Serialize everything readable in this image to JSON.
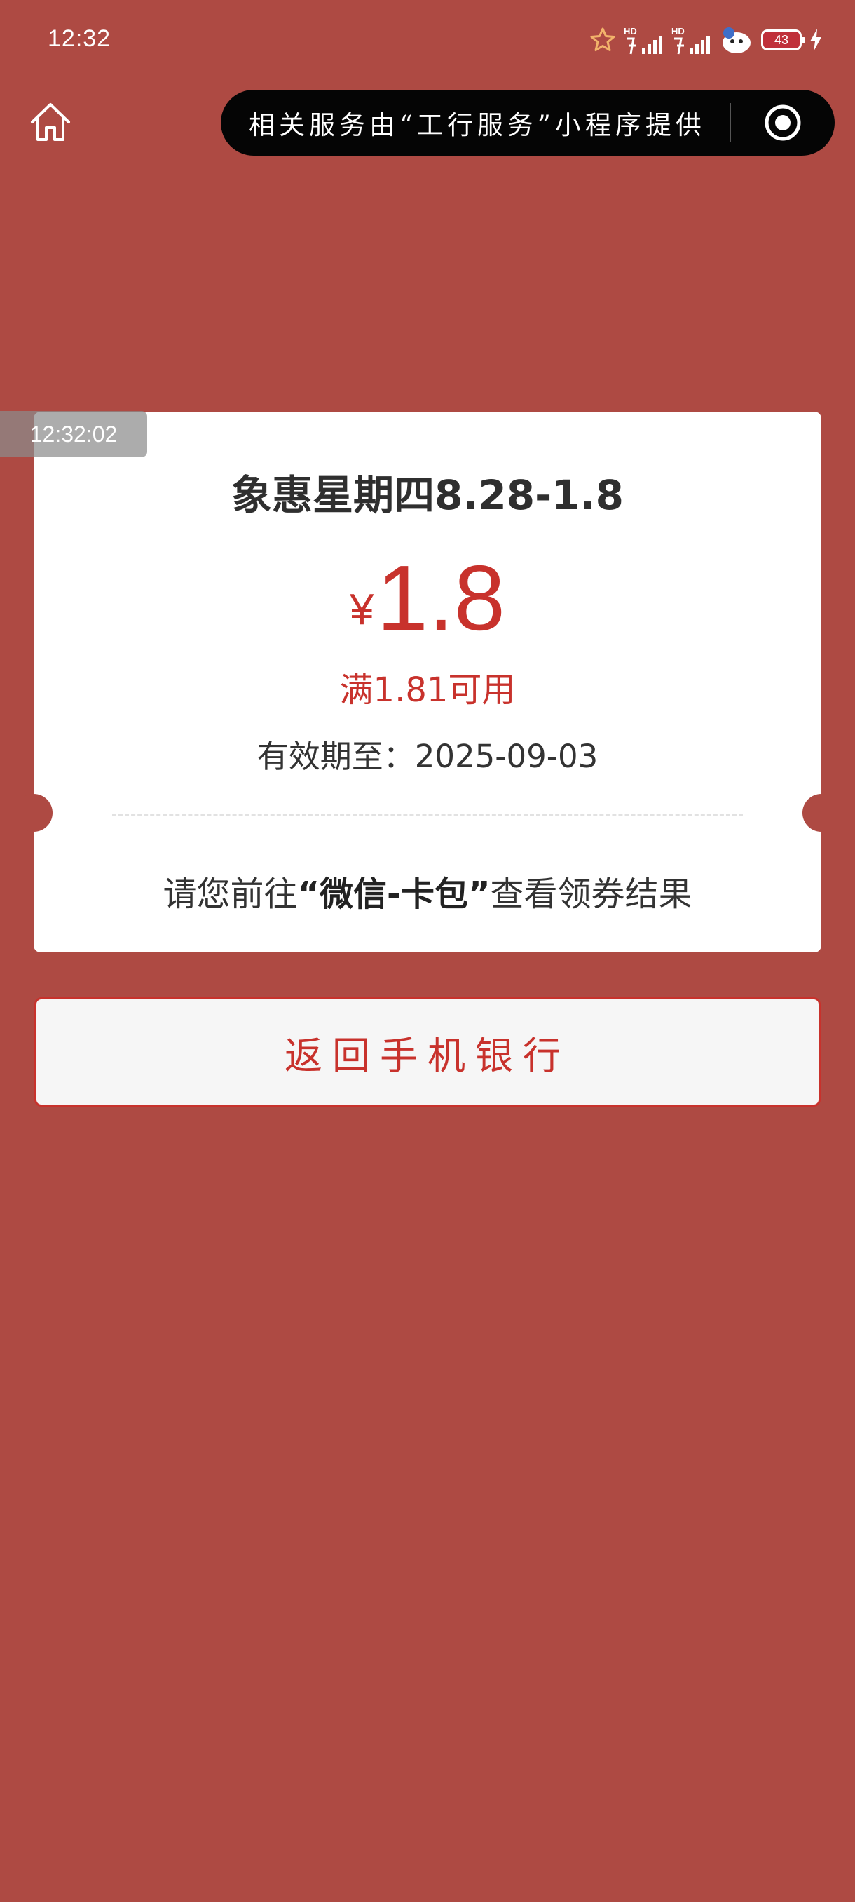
{
  "status_bar": {
    "time": "12:32",
    "battery_level": "43",
    "icons": [
      "notification-star-icon",
      "hd-signal-icon",
      "hd-signal-icon",
      "app-notification-icon",
      "battery-icon",
      "charging-icon"
    ]
  },
  "nav": {
    "home_icon": "home-icon",
    "capsule_text": "相关服务由“工行服务”小程序提供",
    "capsule_icon": "target-icon"
  },
  "coupon": {
    "title": "象惠星期四8.28-1.8",
    "currency": "¥",
    "amount": "1.8",
    "condition": "满1.81可用",
    "validity": "有效期至：2025-09-03",
    "instruction_prefix": "请您前往",
    "instruction_highlight": "“微信-卡包”",
    "instruction_suffix": "查看领券结果"
  },
  "overlay": {
    "timestamp": "12:32:02"
  },
  "actions": {
    "return_label": "返回手机银行"
  },
  "colors": {
    "background": "#ae4a43",
    "accent_red": "#c8322c",
    "card": "#ffffff",
    "capsule": "#050505"
  }
}
